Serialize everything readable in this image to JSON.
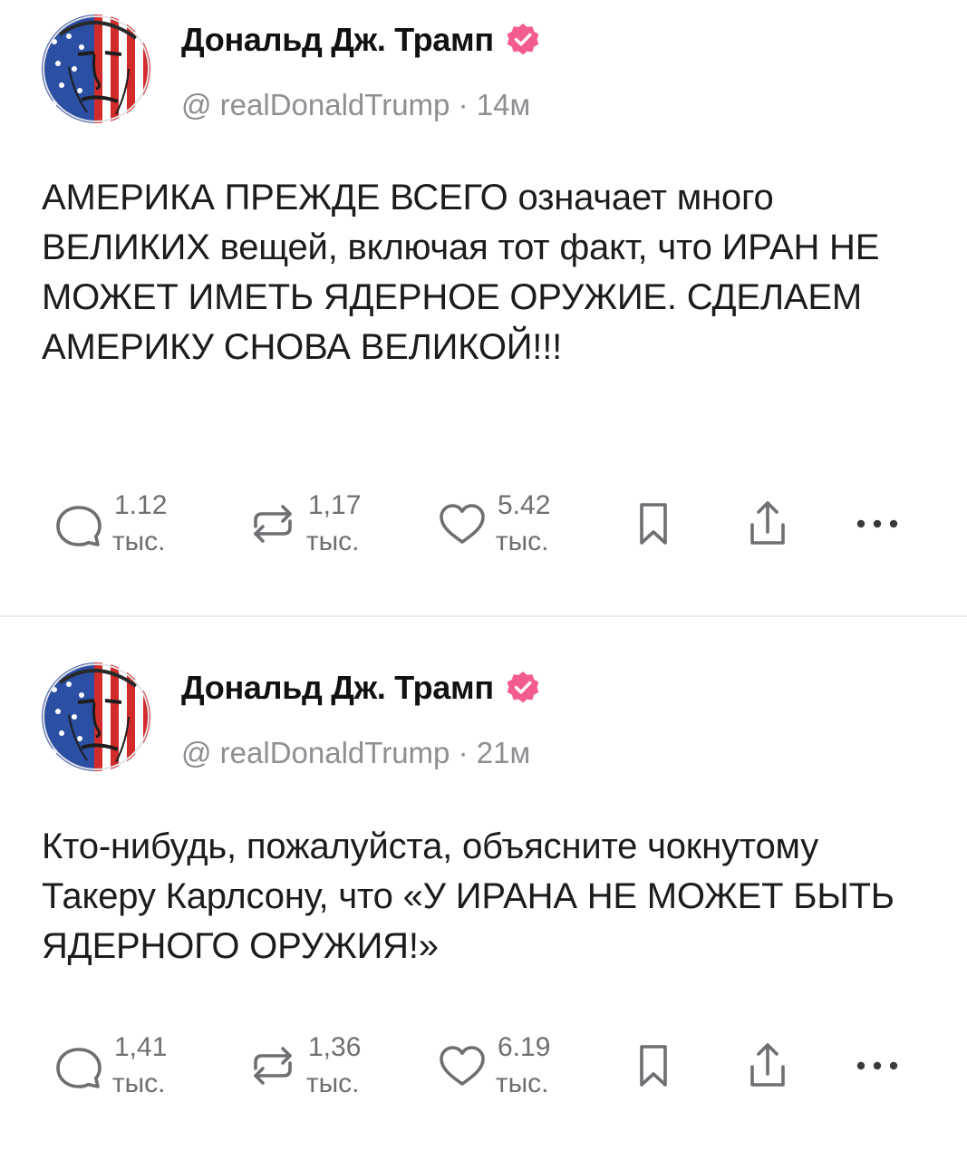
{
  "colors": {
    "verified_badge": "#f25d8e",
    "icon_stroke": "#6e6e73",
    "text_primary": "#1c1c1e",
    "text_secondary": "#8e8e93"
  },
  "posts": [
    {
      "author": {
        "name": "Дональд Дж. Трамп",
        "verified_icon": "verified-badge-icon"
      },
      "handle": "@ realDonaldTrump",
      "separator": "·",
      "time": "14м",
      "text": "АМЕРИКА ПРЕЖДЕ ВСЕГО означает много ВЕЛИКИХ вещей, включая тот факт, что ИРАН НЕ МОЖЕТ ИМЕТЬ ЯДЕРНОЕ ОРУЖИЕ. СДЕЛАЕМ АМЕРИКУ СНОВА ВЕЛИКОЙ!!!",
      "stats": {
        "replies": {
          "value": "1.12",
          "unit": "тыс."
        },
        "reposts": {
          "value": "1,17",
          "unit": "тыс."
        },
        "likes": {
          "value": "5.42",
          "unit": "тыс."
        }
      }
    },
    {
      "author": {
        "name": "Дональд Дж. Трамп",
        "verified_icon": "verified-badge-icon"
      },
      "handle": "@ realDonaldTrump",
      "separator": "·",
      "time": "21м",
      "text": "Кто-нибудь, пожалуйста, объясните чокнутому Такеру Карлсону, что «У ИРАНА НЕ МОЖЕТ БЫТЬ ЯДЕРНОГО ОРУЖИЯ!»",
      "stats": {
        "replies": {
          "value": "1,41",
          "unit": "тыс."
        },
        "reposts": {
          "value": "1,36",
          "unit": "тыс."
        },
        "likes": {
          "value": "6.19",
          "unit": "тыс."
        }
      }
    }
  ],
  "icons": [
    "reply-icon",
    "repost-icon",
    "like-icon",
    "bookmark-icon",
    "share-icon",
    "more-icon"
  ]
}
